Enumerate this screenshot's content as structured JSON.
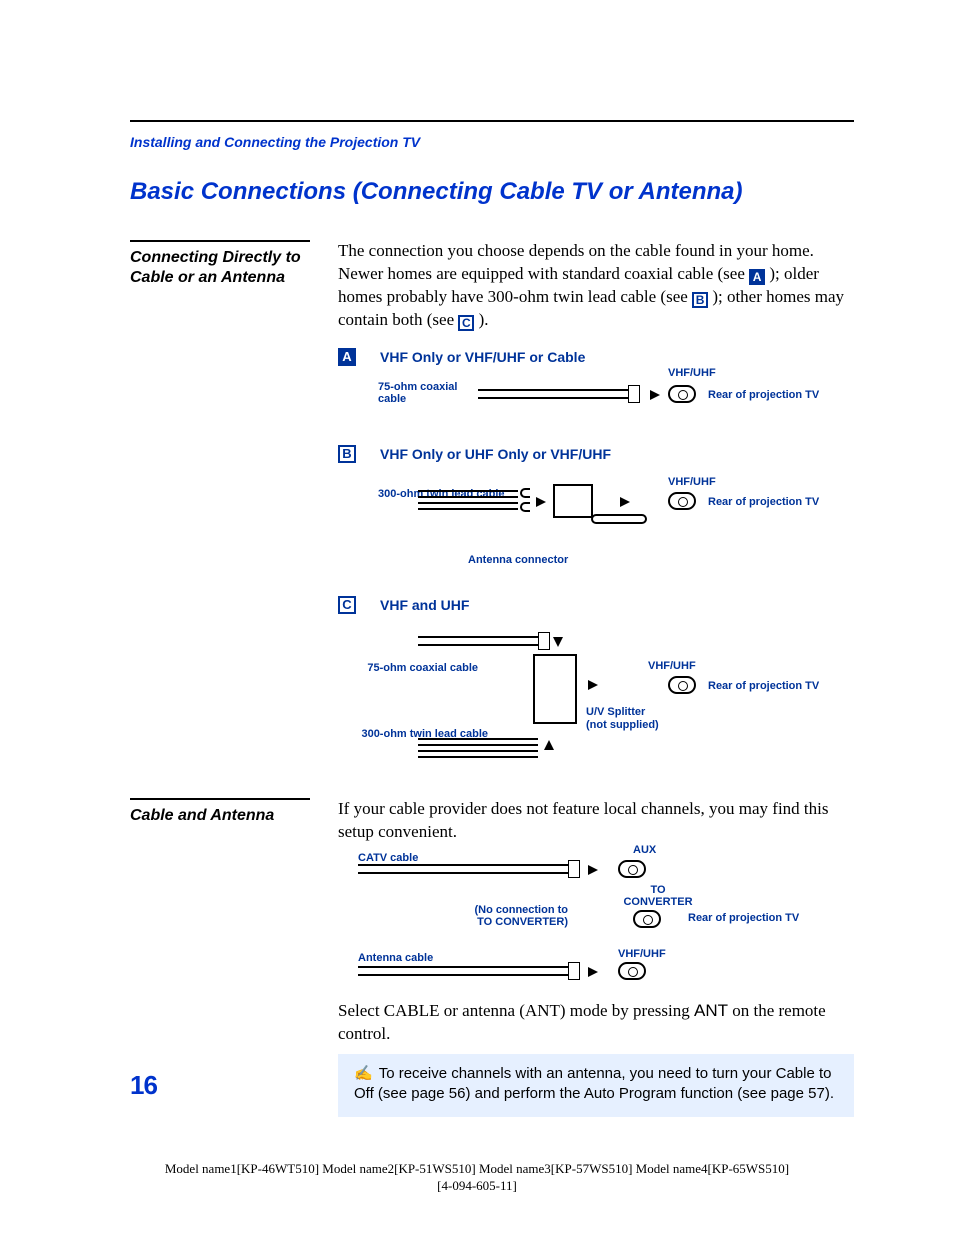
{
  "chapter_crumb": "Installing and Connecting the Projection TV",
  "page_title": "Basic Connections (Connecting Cable TV or Antenna)",
  "section1": {
    "side_heading": "Connecting Directly to Cable or an Antenna",
    "intro_part1": "The connection you choose depends on the cable found in your home. Newer homes are equipped with standard coaxial cable (see ",
    "chipA": "A",
    "intro_part2": "); older homes probably have 300-ohm twin lead cable (see ",
    "chipB": "B",
    "intro_part3": "); other homes may contain both (see ",
    "chipC": "C",
    "intro_part4": ")."
  },
  "diagA": {
    "chip": "A",
    "title": "VHF Only or VHF/UHF or Cable",
    "label_cable": "75-ohm coaxial cable",
    "label_port": "VHF/UHF",
    "label_rear": "Rear of projection TV"
  },
  "diagB": {
    "chip": "B",
    "title": "VHF Only or UHF Only or VHF/UHF",
    "label_cable": "300-ohm twin lead cable",
    "label_connector": "Antenna connector",
    "label_port": "VHF/UHF",
    "label_rear": "Rear of projection TV"
  },
  "diagC": {
    "chip": "C",
    "title": "VHF and UHF",
    "label_coax": "75-ohm coaxial cable",
    "label_twin": "300-ohm twin lead cable",
    "label_splitter": "U/V Splitter (not supplied)",
    "label_port": "VHF/UHF",
    "label_rear": "Rear of projection TV"
  },
  "section2": {
    "side_heading": "Cable and Antenna",
    "para1": "If your cable provider does not feature local channels, you may find this setup convenient.",
    "diag": {
      "label_catv": "CATV cable",
      "label_aux": "AUX",
      "label_toconv": "TO CONVERTER",
      "label_noconn": "(No connection to TO CONVERTER)",
      "label_antenna": "Antenna cable",
      "label_vhfuhf": "VHF/UHF",
      "label_rear": "Rear of projection TV"
    },
    "para2a": "Select CABLE or antenna (ANT) mode by pressing ",
    "para2_ant": "ANT",
    "para2b": " on the remote control.",
    "note": "To receive channels with an antenna, you need to turn your Cable to Off (see page 56) and perform the Auto Program function (see page 57)."
  },
  "page_number": "16",
  "footer_line1": "Model name1[KP-46WT510]  Model name2[KP-51WS510]  Model name3[KP-57WS510]  Model name4[KP-65WS510]",
  "footer_line2": "[4-094-605-11]"
}
